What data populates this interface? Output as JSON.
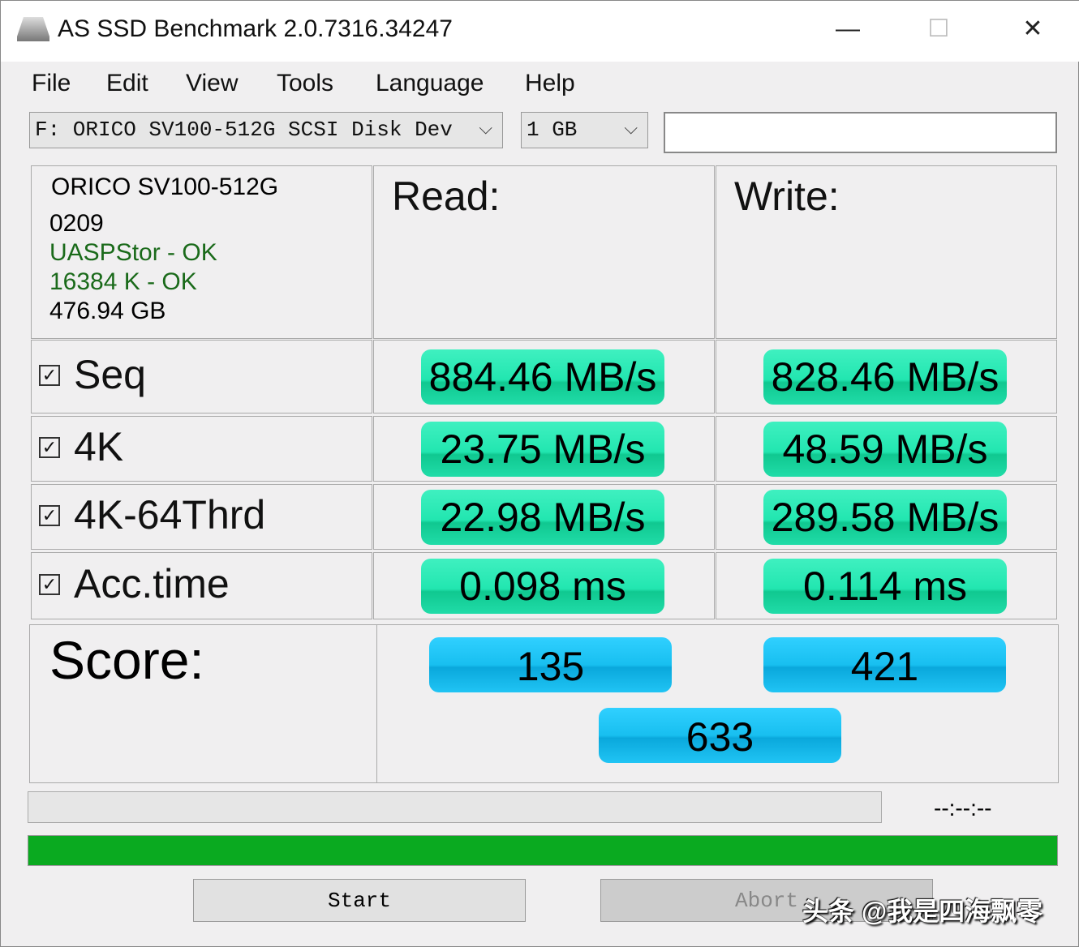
{
  "window": {
    "title": "AS SSD Benchmark 2.0.7316.34247",
    "minimize": "—",
    "maximize": "☐",
    "close": "✕"
  },
  "menu": [
    "File",
    "Edit",
    "View",
    "Tools",
    "Language",
    "Help"
  ],
  "toolbar": {
    "drive": "F: ORICO SV100-512G SCSI Disk Dev",
    "size": "1 GB",
    "chevron": "⌵",
    "extra": ""
  },
  "info": {
    "model": "ORICO SV100-512G",
    "firmware": "0209",
    "driver": "UASPStor - OK",
    "alignment": "16384 K - OK",
    "capacity": "476.94 GB",
    "ok_color": "#1a6a1a"
  },
  "headers": {
    "read": "Read:",
    "write": "Write:"
  },
  "rows": [
    {
      "label": "Seq",
      "checked": true,
      "read": "884.46 MB/s",
      "write": "828.46 MB/s"
    },
    {
      "label": "4K",
      "checked": true,
      "read": "23.75 MB/s",
      "write": "48.59 MB/s"
    },
    {
      "label": "4K-64Thrd",
      "checked": true,
      "read": "22.98 MB/s",
      "write": "289.58 MB/s"
    },
    {
      "label": "Acc.time",
      "checked": true,
      "read": "0.098 ms",
      "write": "0.114 ms"
    }
  ],
  "score": {
    "label": "Score:",
    "read": "135",
    "write": "421",
    "total": "633"
  },
  "progress": {
    "time": "--:--:--",
    "test_progress_percent": 0,
    "overall_progress_percent": 100,
    "bar_color": "#0aaa20"
  },
  "buttons": {
    "start": "Start",
    "abort": "Abort"
  },
  "watermark": "头条 @我是四海飘零"
}
